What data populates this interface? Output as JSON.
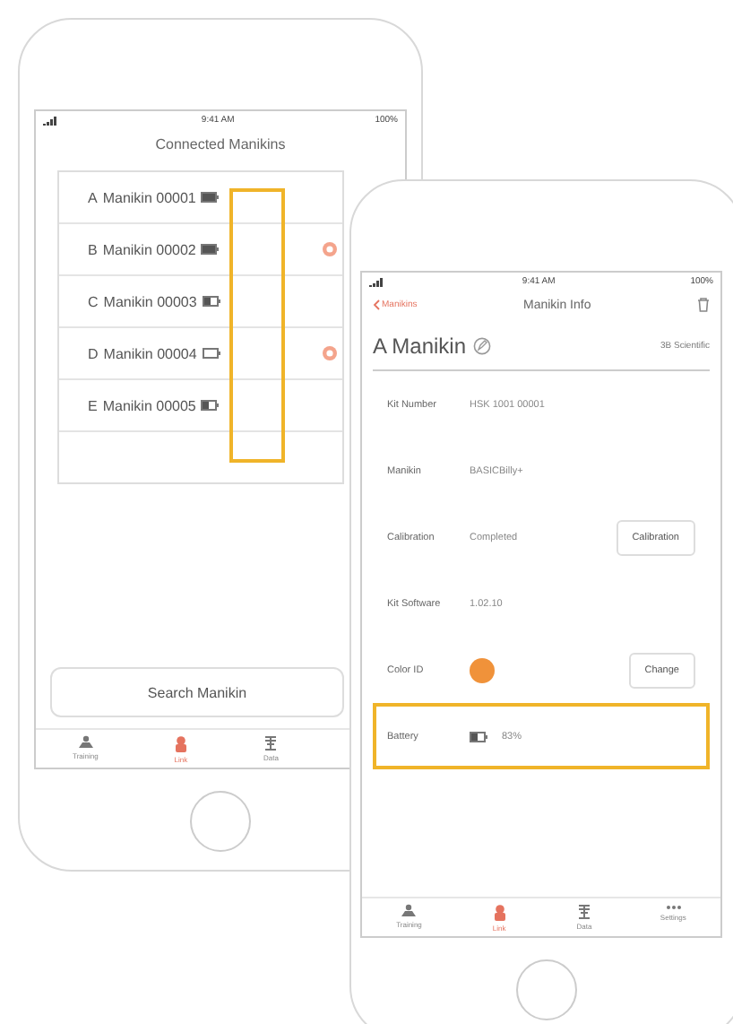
{
  "list_phone": {
    "status": {
      "time": "9:41 AM",
      "battery": "100%"
    },
    "title": "Connected Manikins",
    "manikins": [
      {
        "letter": "A",
        "name": "Manikin 00001",
        "kind": "full",
        "alert": false
      },
      {
        "letter": "B",
        "name": "Manikin 00002",
        "kind": "full",
        "alert": true
      },
      {
        "letter": "C",
        "name": "Manikin 00003",
        "kind": "half",
        "alert": false
      },
      {
        "letter": "D",
        "name": "Manikin 00004",
        "kind": "empty",
        "alert": true
      },
      {
        "letter": "E",
        "name": "Manikin 00005",
        "kind": "half",
        "alert": false
      }
    ],
    "search_button": "Search Manikin",
    "tabs": [
      {
        "label": "Training",
        "kind": "training",
        "selected": false
      },
      {
        "label": "Link",
        "kind": "link",
        "selected": true
      },
      {
        "label": "Data",
        "kind": "data",
        "selected": false
      }
    ]
  },
  "info_phone": {
    "status": {
      "time": "9:41 AM",
      "battery": "100%"
    },
    "back": "Manikins",
    "title": "Manikin Info",
    "name": "A Manikin",
    "brand": "3B Scientific",
    "fields": [
      {
        "label": "Kit Number",
        "value": "HSK 1001 00001",
        "kind": "text"
      },
      {
        "label": "Manikin",
        "value": "BASICBilly+",
        "kind": "text"
      },
      {
        "label": "Calibration",
        "value": "Completed",
        "kind": "button",
        "button": "Calibration"
      },
      {
        "label": "Kit Software",
        "value": "1.02.10",
        "kind": "text"
      },
      {
        "label": "Color ID",
        "kind": "color",
        "color": "#f0923a",
        "button": "Change"
      },
      {
        "label": "Battery",
        "value": "83%",
        "kind": "battery"
      }
    ],
    "tabs": [
      {
        "label": "Training",
        "kind": "training",
        "selected": false
      },
      {
        "label": "Link",
        "kind": "link",
        "selected": true
      },
      {
        "label": "Data",
        "kind": "data",
        "selected": false
      },
      {
        "label": "Settings",
        "kind": "settings",
        "selected": false
      }
    ]
  }
}
